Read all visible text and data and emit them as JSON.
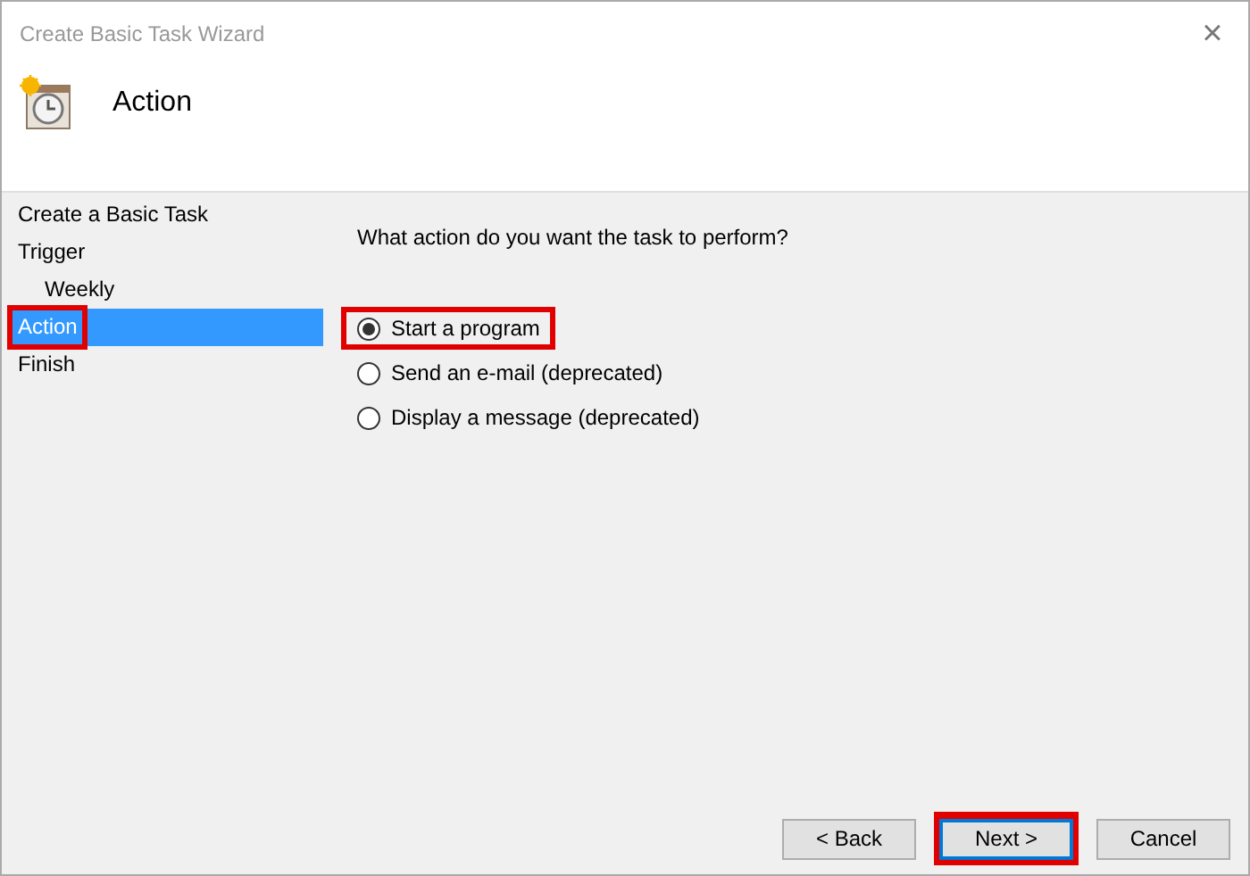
{
  "window": {
    "title": "Create Basic Task Wizard",
    "close": "×"
  },
  "header": {
    "title": "Action"
  },
  "steps": [
    {
      "label": "Create a Basic Task",
      "selected": false,
      "highlighted": false
    },
    {
      "label": "Trigger",
      "selected": false,
      "highlighted": false,
      "children": [
        {
          "label": "Weekly",
          "selected": false,
          "highlighted": false
        }
      ]
    },
    {
      "label": "Action",
      "selected": true,
      "highlighted": true
    },
    {
      "label": "Finish",
      "selected": false,
      "highlighted": false
    }
  ],
  "question": "What action do you want the task to perform?",
  "options": [
    {
      "label": "Start a program",
      "selected": true,
      "highlighted": true
    },
    {
      "label": "Send an e-mail (deprecated)",
      "selected": false,
      "highlighted": false
    },
    {
      "label": "Display a message (deprecated)",
      "selected": false,
      "highlighted": false
    }
  ],
  "buttons": [
    {
      "label": "< Back",
      "kind": "normal",
      "highlighted": false
    },
    {
      "label": "Next >",
      "kind": "default",
      "highlighted": true
    },
    {
      "label": "Cancel",
      "kind": "normal",
      "highlighted": false
    }
  ]
}
